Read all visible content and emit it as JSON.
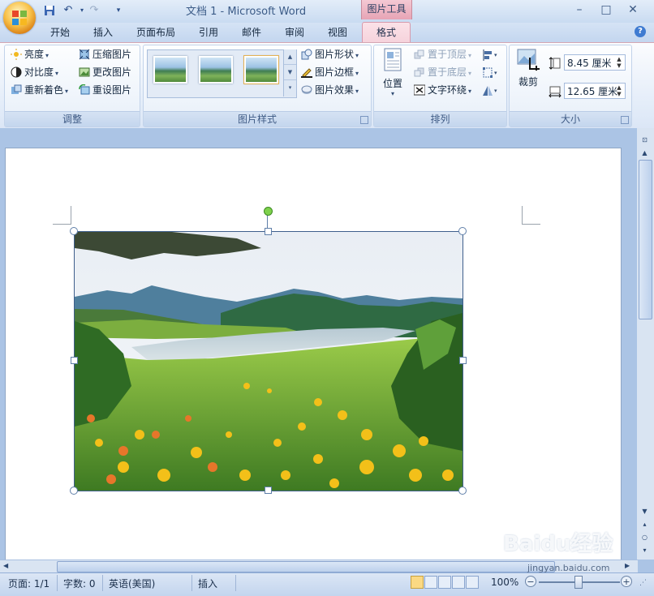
{
  "window": {
    "app_title": "文档 1 - Microsoft Word",
    "context_group": "图片工具",
    "minimize": "–",
    "maximize": "□",
    "close": "✕"
  },
  "quick_access": {
    "save": "save-icon",
    "undo": "undo-icon",
    "redo": "redo-icon",
    "customize": "▾"
  },
  "tabs": [
    "开始",
    "插入",
    "页面布局",
    "引用",
    "邮件",
    "审阅",
    "视图"
  ],
  "active_tab": "格式",
  "ribbon": {
    "adjust": {
      "label": "调整",
      "items": [
        {
          "label": "亮度",
          "icon": "brightness-icon",
          "dropdown": true
        },
        {
          "label": "对比度",
          "icon": "contrast-icon",
          "dropdown": true
        },
        {
          "label": "重新着色",
          "icon": "recolor-icon",
          "dropdown": true
        },
        {
          "label": "压缩图片",
          "icon": "compress-icon"
        },
        {
          "label": "更改图片",
          "icon": "change-picture-icon"
        },
        {
          "label": "重设图片",
          "icon": "reset-picture-icon"
        }
      ]
    },
    "styles": {
      "label": "图片样式",
      "items": [
        {
          "label": "图片形状",
          "icon": "shape-icon"
        },
        {
          "label": "图片边框",
          "icon": "border-icon"
        },
        {
          "label": "图片效果",
          "icon": "effects-icon"
        }
      ]
    },
    "arrange": {
      "label": "排列",
      "position": "位置",
      "items": [
        {
          "label": "置于顶层",
          "icon": "bring-front-icon",
          "enabled": false
        },
        {
          "label": "置于底层",
          "icon": "send-back-icon",
          "enabled": false
        },
        {
          "label": "文字环绕",
          "icon": "text-wrap-icon",
          "enabled": true
        }
      ]
    },
    "size": {
      "label": "大小",
      "crop": "裁剪",
      "height": "8.45 厘米",
      "width": "12.65 厘米"
    }
  },
  "status": {
    "page": "页面: 1/1",
    "words": "字数: 0",
    "language": "英语(美国)",
    "mode": "插入",
    "zoom": "100%",
    "zoom_minus": "−",
    "zoom_plus": "+"
  },
  "watermark": {
    "brand": "Baidu经验",
    "url": "jingyan.baidu.com"
  },
  "colors": {
    "ribbon_bg": "#e4edf9",
    "context_tab": "#f6d3dc",
    "page_bg": "#ffffff",
    "workspace": "#abc4e5"
  }
}
